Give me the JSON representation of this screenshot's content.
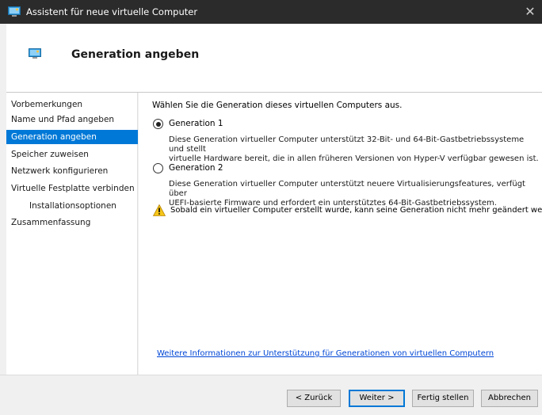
{
  "window": {
    "title": "Assistent für neue virtuelle Computer",
    "close_glyph": "✕",
    "app_icon": "vm-wizard-icon"
  },
  "header": {
    "title": "Generation angeben",
    "icon": "vm-wizard-icon"
  },
  "nav": {
    "items": [
      {
        "label": "Vorbemerkungen",
        "selected": false,
        "indent": false
      },
      {
        "label": "Name und Pfad angeben",
        "selected": false,
        "indent": false
      },
      {
        "label": "Generation angeben",
        "selected": true,
        "indent": false
      },
      {
        "label": "Speicher zuweisen",
        "selected": false,
        "indent": false
      },
      {
        "label": "Netzwerk konfigurieren",
        "selected": false,
        "indent": false
      },
      {
        "label": "Virtuelle Festplatte verbinden",
        "selected": false,
        "indent": false
      },
      {
        "label": "Installationsoptionen",
        "selected": false,
        "indent": true
      },
      {
        "label": "Zusammenfassung",
        "selected": false,
        "indent": false
      }
    ]
  },
  "content": {
    "intro": "Wählen Sie die Generation dieses virtuellen Computers aus.",
    "options": [
      {
        "label": "Generation 1",
        "checked": true,
        "desc_line1": "Diese Generation virtueller Computer unterstützt 32-Bit- und 64-Bit-Gastbetriebssysteme und stellt",
        "desc_line2": "virtuelle Hardware bereit, die in allen früheren Versionen von Hyper-V verfügbar gewesen ist."
      },
      {
        "label": "Generation 2",
        "checked": false,
        "desc_line1": "Diese Generation virtueller Computer unterstützt neuere Virtualisierungsfeatures, verfügt über",
        "desc_line2": "UEFI-basierte Firmware und erfordert ein unterstütztes 64-Bit-Gastbetriebssystem."
      }
    ],
    "warning": "Sobald ein virtueller Computer erstellt wurde, kann seine Generation nicht mehr geändert werden.",
    "warning_icon": "warning-icon",
    "link": "Weitere Informationen zur Unterstützung für Generationen von virtuellen Computern"
  },
  "footer": {
    "back": "< Zurück",
    "next": "Weiter >",
    "finish": "Fertig stellen",
    "cancel": "Abbrechen"
  },
  "colors": {
    "selection": "#0078d7",
    "link": "#0046d5",
    "titlebar": "#2b2b2b"
  }
}
